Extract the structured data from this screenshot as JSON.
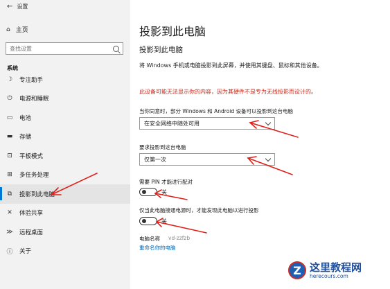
{
  "window": {
    "title": "设置"
  },
  "sidebar": {
    "home": "主页",
    "search_placeholder": "查找设置",
    "section": "系统",
    "items": [
      {
        "label": "专注助手",
        "icon": "moon-icon"
      },
      {
        "label": "电源和睡眠",
        "icon": "power-icon"
      },
      {
        "label": "电池",
        "icon": "battery-icon"
      },
      {
        "label": "存储",
        "icon": "storage-icon"
      },
      {
        "label": "平板模式",
        "icon": "tablet-icon"
      },
      {
        "label": "多任务处理",
        "icon": "multitask-icon"
      },
      {
        "label": "投影到此电脑",
        "icon": "project-icon",
        "active": true
      },
      {
        "label": "体验共享",
        "icon": "share-icon"
      },
      {
        "label": "远程桌面",
        "icon": "remote-icon"
      },
      {
        "label": "关于",
        "icon": "info-icon"
      }
    ]
  },
  "main": {
    "page_title": "投影到此电脑",
    "section_title": "投影到此电脑",
    "description": "将 Windows 手机或电脑投影到此屏幕，并使用其键盘、鼠标和其他设备。",
    "warning": "此设备可能无法显示你的内容，因为其硬件不是专为无线投影而设计的。",
    "availability_label": "当你同意时，部分 Windows 和 Android 设备可以投影到这台电脑",
    "availability_value": "在安全网络中随处可用",
    "ask_label": "要求投影到这台电脑",
    "ask_value": "仅第一次",
    "pin_label": "需要 PIN 才能进行配对",
    "pin_state": "关",
    "power_label": "仅当此电脑接通电源时，才能发现此电脑以进行投影",
    "power_state": "关",
    "pc_name_label": "电脑名称",
    "pc_name_value": "vd-zzfzb",
    "rename_link": "重命名你的电脑"
  },
  "watermark": {
    "cn": "这里教程网",
    "en": "herecours.com",
    "logo_letter": "Z"
  },
  "colors": {
    "accent": "#0078d7",
    "warning": "#c42b1c",
    "arrow": "#e0201a"
  }
}
